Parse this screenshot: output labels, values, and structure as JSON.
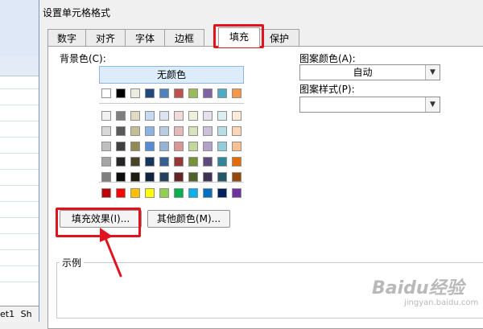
{
  "background": {
    "sheet_tab": "et1",
    "sheet_tab_2": "Sh"
  },
  "dialog": {
    "title": "设置单元格格式",
    "tabs": [
      {
        "label": "数字"
      },
      {
        "label": "对齐"
      },
      {
        "label": "字体"
      },
      {
        "label": "边框"
      },
      {
        "label": "填充",
        "selected": true
      },
      {
        "label": "保护"
      }
    ],
    "background_color": {
      "label": "背景色(C):",
      "no_color_label": "无颜色",
      "selected": "无颜色",
      "palette_colors": {
        "row1": [
          "#ffffff",
          "#000000",
          "#eeece1",
          "#1f497d",
          "#4f81bd",
          "#c0504d",
          "#9bbb59",
          "#8064a2",
          "#4bacc6",
          "#f79646"
        ],
        "tints": [
          [
            "#f2f2f2",
            "#7f7f7f",
            "#ddd9c3",
            "#c6d9f0",
            "#dbe5f1",
            "#f2dcdb",
            "#ebf1dd",
            "#e5e0ec",
            "#dbeef3",
            "#fdeada"
          ],
          [
            "#d8d8d8",
            "#595959",
            "#c4bd97",
            "#8db3e2",
            "#b8cce4",
            "#e5b9b7",
            "#d7e3bc",
            "#ccc1d9",
            "#b7dde8",
            "#fbd5b5"
          ],
          [
            "#bfbfbf",
            "#3f3f3f",
            "#938953",
            "#548dd4",
            "#95b3d7",
            "#d99694",
            "#c3d69b",
            "#b2a2c7",
            "#92cddc",
            "#fac08f"
          ],
          [
            "#a5a5a5",
            "#262626",
            "#494429",
            "#17365d",
            "#366092",
            "#953734",
            "#76923c",
            "#5f497a",
            "#31859b",
            "#e36c09"
          ],
          [
            "#7f7f7f",
            "#0c0c0c",
            "#1d1b10",
            "#0f243e",
            "#244061",
            "#632423",
            "#4f6128",
            "#3f3151",
            "#205867",
            "#974806"
          ]
        ],
        "standard": [
          "#c00000",
          "#ff0000",
          "#ffc000",
          "#ffff00",
          "#92d050",
          "#00b050",
          "#00b0f0",
          "#0070c0",
          "#002060",
          "#7030a0"
        ]
      }
    },
    "pattern_color": {
      "label": "图案颜色(A):",
      "value": "自动"
    },
    "pattern_style": {
      "label": "图案样式(P):",
      "value": ""
    },
    "buttons": {
      "fill_effects": "填充效果(I)...",
      "more_colors": "其他颜色(M)..."
    },
    "sample": {
      "label": "示例"
    }
  },
  "watermark": {
    "main": "Baidu经验",
    "sub": "jingyan.baidu.com"
  },
  "colors": {
    "highlight": "#e0141e",
    "accent": "#8fb6e0"
  }
}
